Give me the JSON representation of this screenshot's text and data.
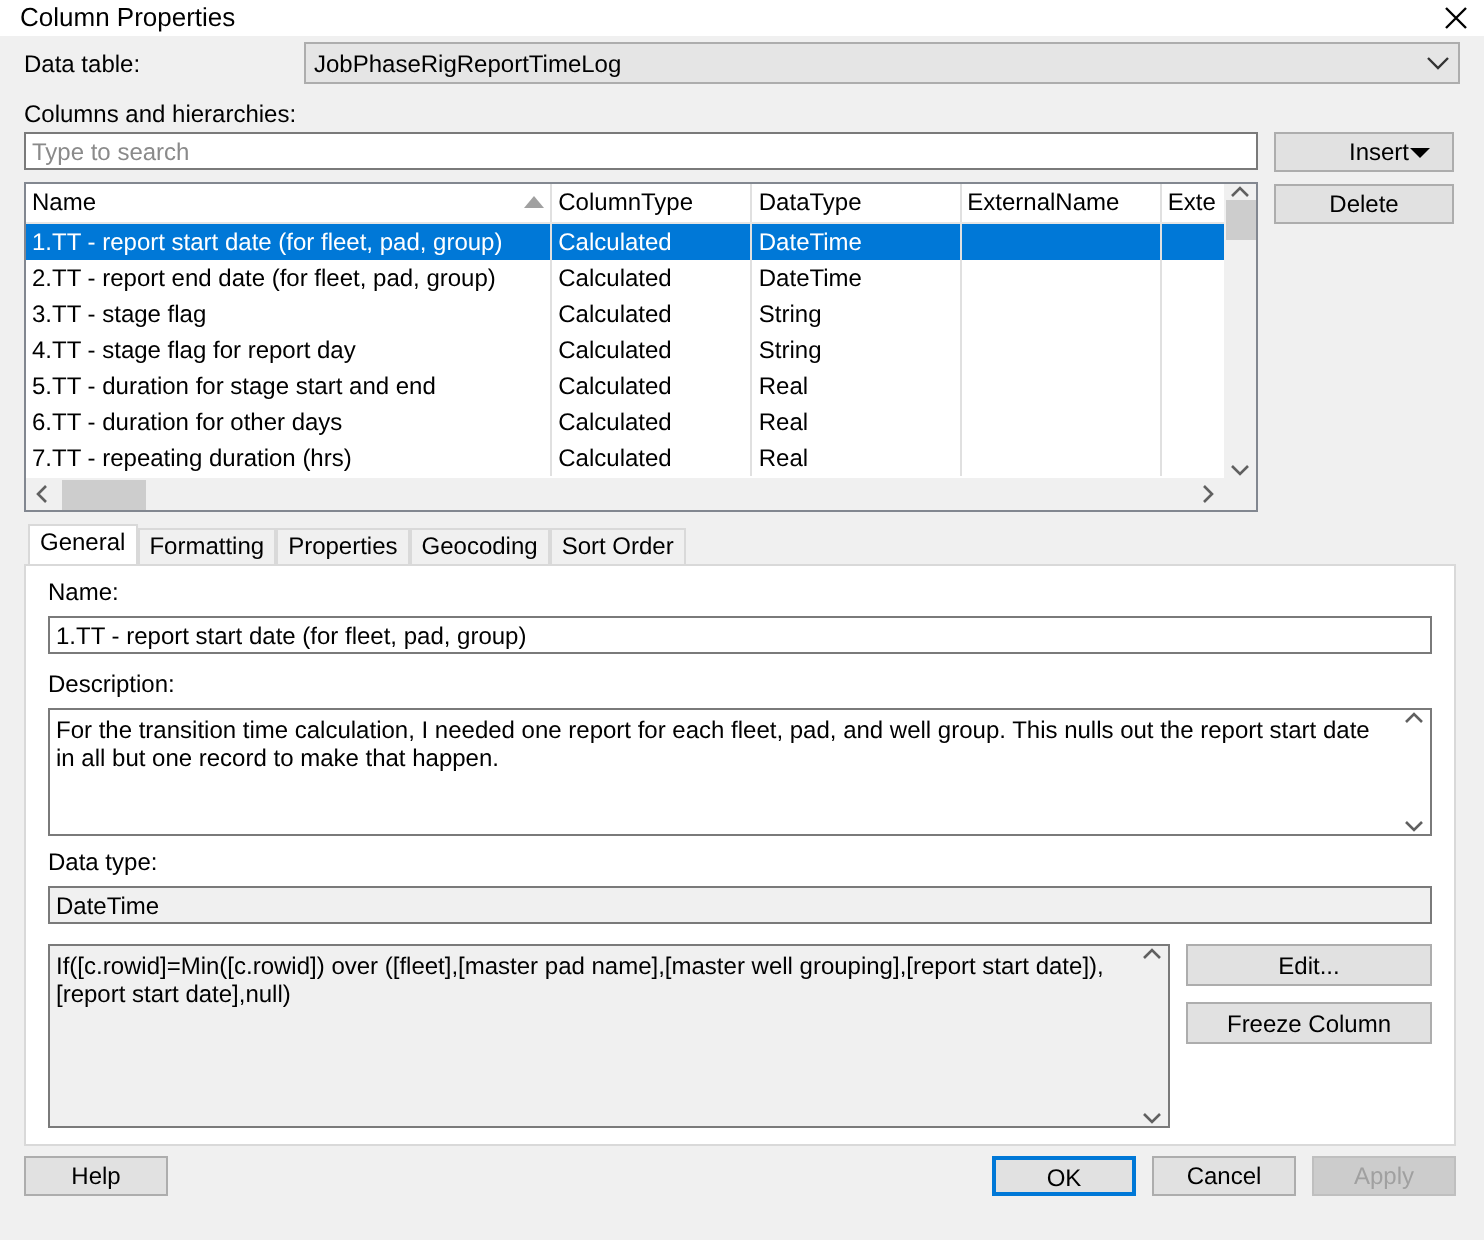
{
  "window": {
    "title": "Column Properties"
  },
  "data_table": {
    "label": "Data table:",
    "value": "JobPhaseRigReportTimeLog"
  },
  "columns_label": "Columns and hierarchies:",
  "search": {
    "placeholder": "Type to search"
  },
  "side_buttons": [
    {
      "label": "Insert",
      "kind": "dropdown"
    },
    {
      "label": "Delete",
      "kind": "plain"
    }
  ],
  "grid": {
    "columns": [
      {
        "label": "Name",
        "sorted": true
      },
      {
        "label": "ColumnType",
        "sorted": false
      },
      {
        "label": "DataType",
        "sorted": false
      },
      {
        "label": "ExternalName",
        "sorted": false
      },
      {
        "label": "Exte",
        "sorted": false
      }
    ],
    "rows": [
      {
        "cells": [
          "1.TT - report start date (for fleet, pad, group)",
          "Calculated",
          "DateTime"
        ],
        "selected": true
      },
      {
        "cells": [
          "2.TT - report end date (for fleet, pad, group)",
          "Calculated",
          "DateTime"
        ],
        "selected": false
      },
      {
        "cells": [
          "3.TT - stage flag",
          "Calculated",
          "String"
        ],
        "selected": false
      },
      {
        "cells": [
          "4.TT - stage flag for report day",
          "Calculated",
          "String"
        ],
        "selected": false
      },
      {
        "cells": [
          "5.TT - duration for stage start and end",
          "Calculated",
          "Real"
        ],
        "selected": false
      },
      {
        "cells": [
          "6.TT - duration for other days",
          "Calculated",
          "Real"
        ],
        "selected": false
      },
      {
        "cells": [
          "7.TT - repeating duration (hrs)",
          "Calculated",
          "Real"
        ],
        "selected": false
      }
    ]
  },
  "tabs": [
    {
      "label": "General",
      "selected": true
    },
    {
      "label": "Formatting",
      "selected": false
    },
    {
      "label": "Properties",
      "selected": false
    },
    {
      "label": "Geocoding",
      "selected": false
    },
    {
      "label": "Sort Order",
      "selected": false
    }
  ],
  "general": {
    "name_label": "Name:",
    "name_value": "1.TT - report start date (for fleet, pad, group)",
    "description_label": "Description:",
    "description": "For the transition time calculation, I needed one report for each fleet, pad, and well group.  This nulls out the report start date in all but one record to make that happen.",
    "data_type_label": "Data type:",
    "data_type": "DateTime",
    "expression": "If([c.rowid]=Min([c.rowid]) over ([fleet],[master pad name],[master well grouping],[report start date]),[report start date],null)",
    "expression_buttons": [
      "Edit...",
      "Freeze Column"
    ]
  },
  "footer_buttons": [
    {
      "label": "Help",
      "disabled": false,
      "default": false
    },
    {
      "label": "OK",
      "disabled": false,
      "default": true
    },
    {
      "label": "Cancel",
      "disabled": false,
      "default": false
    },
    {
      "label": "Apply",
      "disabled": true,
      "default": false
    }
  ]
}
